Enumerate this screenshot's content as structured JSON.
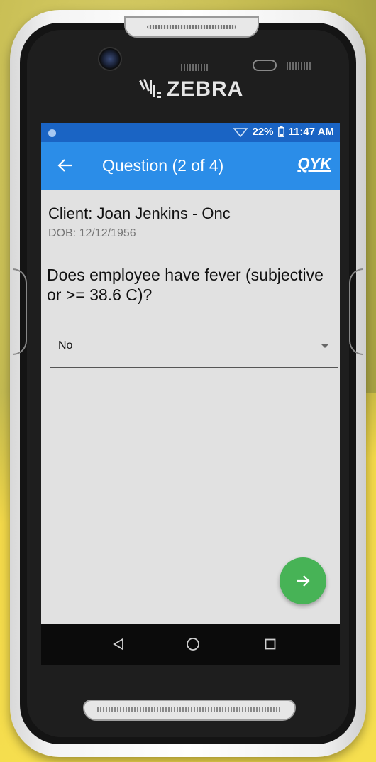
{
  "device": {
    "brand_logo": "ZEBRA"
  },
  "status_bar": {
    "battery": "22%",
    "time": "11:47 AM"
  },
  "app_bar": {
    "title": "Question (2 of 4)",
    "brand": "QYK"
  },
  "client": {
    "name": "Client: Joan Jenkins - Onc",
    "dob": "DOB: 12/12/1956"
  },
  "question": {
    "text": "Does employee have fever (subjective or >= 38.6 C)?"
  },
  "answer_select": {
    "selected": "No"
  },
  "icons": [
    "back-arrow-icon",
    "next-arrow-icon",
    "wifi-icon",
    "battery-icon",
    "nav-back-icon",
    "nav-home-icon",
    "nav-recent-icon"
  ],
  "colors": {
    "status_bar": "#1a64c4",
    "app_bar": "#2b8de8",
    "fab": "#47b356",
    "screen_bg": "#e1e1e1"
  }
}
